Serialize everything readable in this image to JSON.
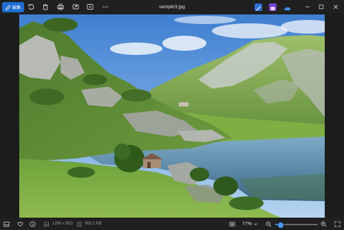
{
  "toolbar": {
    "edit_label": "編集",
    "title": "sample3.jpg"
  },
  "statusbar": {
    "dimensions": "1280 x 853",
    "file_size": "363.2 KB",
    "zoom": "77%",
    "zoom_level": 0.12
  },
  "colors": {
    "accent": "#1f6fd0",
    "slider": "#4c9cff"
  }
}
